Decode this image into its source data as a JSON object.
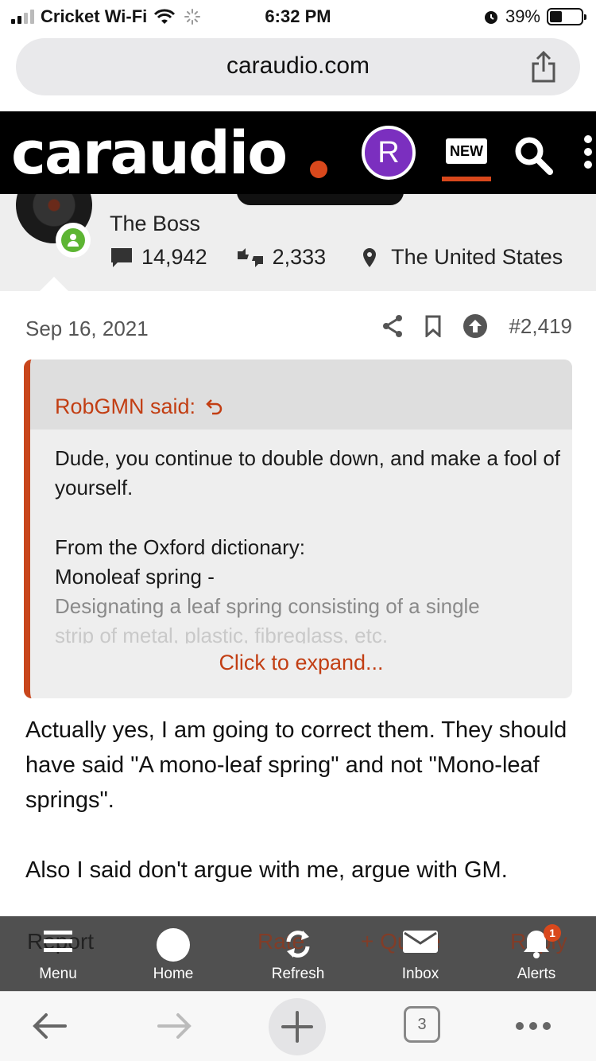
{
  "status_bar": {
    "carrier": "Cricket Wi-Fi",
    "time": "6:32 PM",
    "battery": "39%",
    "battery_level": 0.39
  },
  "browser": {
    "url": "caraudio.com",
    "tab_count": "3"
  },
  "site_header": {
    "logo_text": "caraudio",
    "avatar_letter": "R",
    "new_badge": "NEW",
    "accent_color": "#d9481c"
  },
  "user": {
    "role": "The Boss",
    "messages": "14,942",
    "reactions": "2,333",
    "location": "The United States"
  },
  "post": {
    "date": "Sep 16, 2021",
    "number": "#2,419",
    "quote": {
      "author": "RobGMN said:",
      "line1": "Dude, you continue to double down, and make a fool of yourself.",
      "line2": "From the Oxford dictionary:",
      "line3": "Monoleaf spring -",
      "line4": "Designating a leaf spring consisting of a single",
      "line5": "strip of metal, plastic, fibreglass, etc.",
      "expand": "Click to expand..."
    },
    "body_para1": "Actually yes, I am going to correct them. They should have said \"A mono-leaf spring\" and not \"Mono-leaf springs\".",
    "body_para2": "Also I said don't argue with me, argue with GM."
  },
  "post_footer_ghost": {
    "report": "Report",
    "rate": "Rate",
    "quote": "+ Quote",
    "reply": "Reply"
  },
  "app_nav": {
    "menu": "Menu",
    "home": "Home",
    "refresh": "Refresh",
    "inbox": "Inbox",
    "alerts": "Alerts",
    "alerts_badge": "1"
  }
}
